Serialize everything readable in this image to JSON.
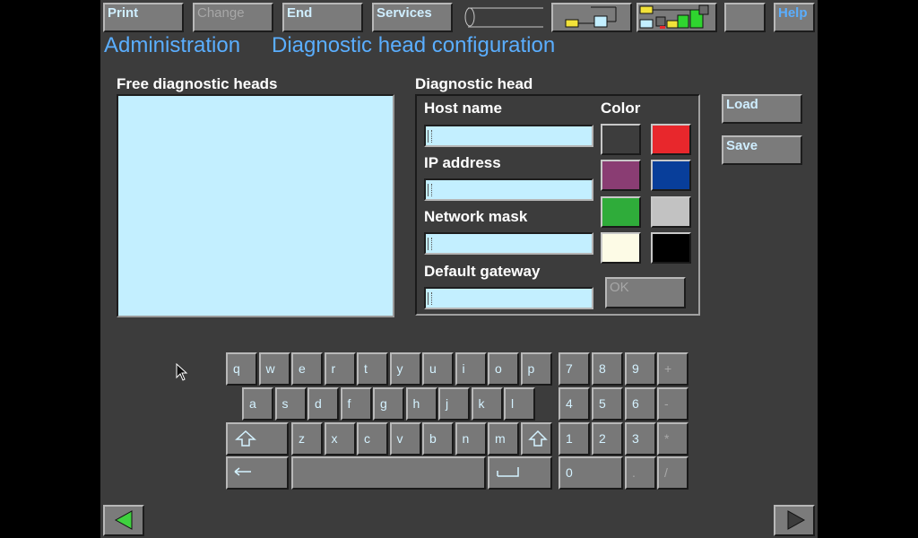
{
  "toolbar": {
    "print": "Print",
    "change": "Change",
    "end": "End",
    "services": "Services",
    "help": "Help"
  },
  "header": {
    "section": "Administration",
    "page": "Diagnostic head configuration"
  },
  "free_heads": {
    "title": "Free diagnostic heads",
    "items": []
  },
  "diag_head": {
    "title": "Diagnostic head",
    "host_label": "Host name",
    "host_value": "",
    "ip_label": "IP address",
    "ip_value": "",
    "mask_label": "Network mask",
    "mask_value": "",
    "gateway_label": "Default gateway",
    "gateway_value": "",
    "color_label": "Color",
    "ok": "OK"
  },
  "colors": [
    "#3d3d3d",
    "#e8272c",
    "#8a3d73",
    "#083e9a",
    "#2fac3a",
    "#c2c2c2",
    "#fdfbe6",
    "#000000"
  ],
  "actions": {
    "load": "Load",
    "save": "Save"
  },
  "keyboard": {
    "row1": [
      "q",
      "w",
      "e",
      "r",
      "t",
      "y",
      "u",
      "i",
      "o",
      "p"
    ],
    "row2": [
      "a",
      "s",
      "d",
      "f",
      "g",
      "h",
      "j",
      "k",
      "l"
    ],
    "row3": [
      "z",
      "x",
      "c",
      "v",
      "b",
      "n",
      "m"
    ],
    "numpad": [
      [
        "7",
        "8",
        "9",
        "+"
      ],
      [
        "4",
        "5",
        "6",
        "-"
      ],
      [
        "1",
        "2",
        "3",
        "*"
      ],
      [
        "0",
        ".",
        "/"
      ]
    ]
  },
  "nav": {
    "back_icon": "triangle-left-icon",
    "forward_icon": "triangle-right-icon"
  }
}
